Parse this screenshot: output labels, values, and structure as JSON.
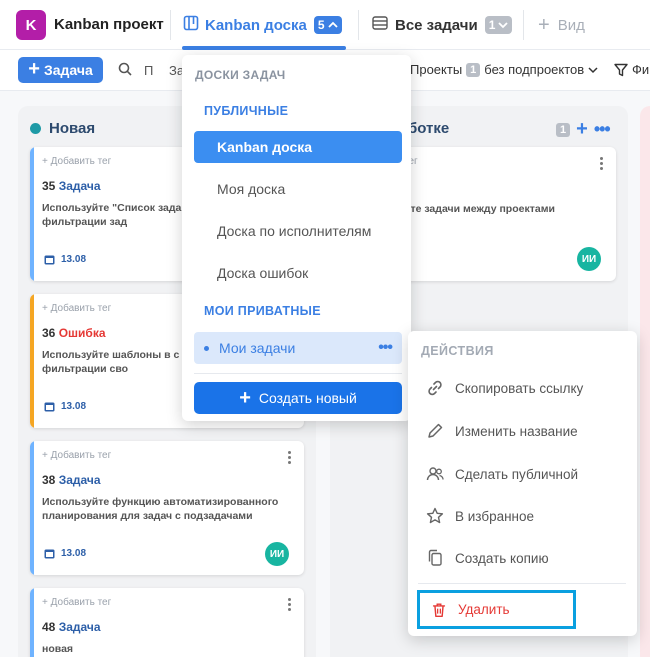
{
  "topbar": {
    "project_avatar_letter": "K",
    "project_name": "Kanban проект",
    "tab_board_label": "Kanban доска",
    "tab_board_count": "5",
    "tab_all_label": "Все задачи",
    "tab_all_count": "1",
    "tab_view_label": "Вид"
  },
  "toolbar": {
    "add_task_label": "Задача",
    "search_text": "П",
    "za_text": "За",
    "projects_label": "Проекты",
    "projects_count": "1",
    "projects_mode": "без подпроектов",
    "filter_label": "Фи"
  },
  "columns": {
    "col1_title": "Новая",
    "col2_title": "ботке",
    "col2_count": "1"
  },
  "cards": [
    {
      "tag": "+ Добавить тег",
      "num": "35",
      "type": "Задача",
      "desc": "Используйте \"Список зада поиска и фильтрации зад",
      "date": "13.08"
    },
    {
      "tag": "+ Добавить тег",
      "num": "36",
      "type": "Ошибка",
      "desc": "Используйте шаблоны в с быстрой фильтрации сво",
      "date": "13.08"
    },
    {
      "tag": "+ Добавить тег",
      "num": "38",
      "type": "Задача",
      "desc": "Используйте функцию автоматизированного планирования для задач с подзадачами",
      "date": "13.08",
      "avatar": "ИИ"
    },
    {
      "tag": "+ Добавить тег",
      "num": "48",
      "type": "Задача",
      "desc": "новая"
    }
  ],
  "card_col2": {
    "tag": "тег",
    "desc": "йте задачи между проектами",
    "avatar": "ИИ"
  },
  "dropdown": {
    "header": "ДОСКИ ЗАДАЧ",
    "public_section": "ПУБЛИЧНЫЕ",
    "public_items": [
      "Kanban доска",
      "Моя доска",
      "Доска по исполнителям",
      "Доска ошибок"
    ],
    "private_section": "МОИ ПРИВАТНЫЕ",
    "private_items": [
      "Мои задачи"
    ],
    "create_label": "Создать новый"
  },
  "actions": {
    "header": "ДЕЙСТВИЯ",
    "items": [
      "Скопировать ссылку",
      "Изменить название",
      "Сделать публичной",
      "В избранное",
      "Создать копию"
    ],
    "delete_label": "Удалить"
  },
  "colors": {
    "accent": "#3b7fe3",
    "danger": "#e53935",
    "teal": "#18b5a1"
  }
}
